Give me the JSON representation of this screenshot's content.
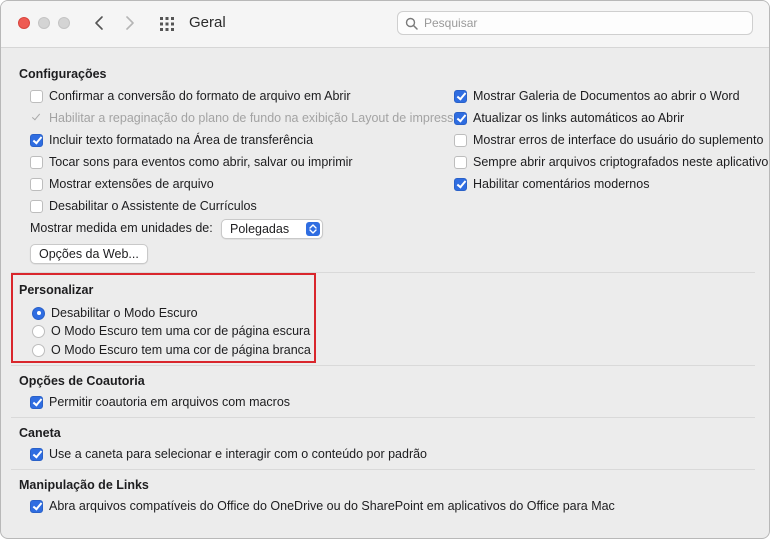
{
  "header": {
    "title": "Geral",
    "search_placeholder": "Pesquisar"
  },
  "configuracoes": {
    "title": "Configurações",
    "left": [
      {
        "label": "Confirmar a conversão do formato de arquivo em Abrir",
        "checked": false,
        "disabled": false
      },
      {
        "label": "Habilitar a repaginação do plano de fundo na exibição Layout de impressão",
        "checked": true,
        "disabled": true
      },
      {
        "label": "Incluir texto formatado na Área de transferência",
        "checked": true,
        "disabled": false
      },
      {
        "label": "Tocar sons para eventos como abrir, salvar ou imprimir",
        "checked": false,
        "disabled": false
      },
      {
        "label": "Mostrar extensões de arquivo",
        "checked": false,
        "disabled": false
      },
      {
        "label": "Desabilitar o Assistente de Currículos",
        "checked": false,
        "disabled": false
      }
    ],
    "right": [
      {
        "label": "Mostrar Galeria de Documentos ao abrir o Word",
        "checked": true
      },
      {
        "label": "Atualizar os links automáticos ao Abrir",
        "checked": true
      },
      {
        "label": "Mostrar erros de interface do usuário do suplemento",
        "checked": false
      },
      {
        "label": "Sempre abrir arquivos criptografados neste aplicativo",
        "checked": false
      },
      {
        "label": "Habilitar comentários modernos",
        "checked": true
      }
    ],
    "units_label": "Mostrar medida em unidades de:",
    "units_value": "Polegadas",
    "web_options_button": "Opções da Web..."
  },
  "personalizar": {
    "title": "Personalizar",
    "options": [
      {
        "label": "Desabilitar o Modo Escuro",
        "selected": true
      },
      {
        "label": "O Modo Escuro tem uma cor de página escura",
        "selected": false
      },
      {
        "label": "O Modo Escuro tem uma cor de página branca",
        "selected": false
      }
    ]
  },
  "coautoria": {
    "title": "Opções de Coautoria",
    "item": "Permitir coautoria em arquivos com macros"
  },
  "caneta": {
    "title": "Caneta",
    "item": "Use a caneta para selecionar e interagir com o conteúdo por padrão"
  },
  "links": {
    "title": "Manipulação de Links",
    "item": "Abra arquivos compatíveis do Office do OneDrive ou do SharePoint em aplicativos do Office para Mac"
  },
  "colors": {
    "accent": "#2f6de1",
    "highlight": "#d9262c",
    "close": "#ee5a52"
  }
}
